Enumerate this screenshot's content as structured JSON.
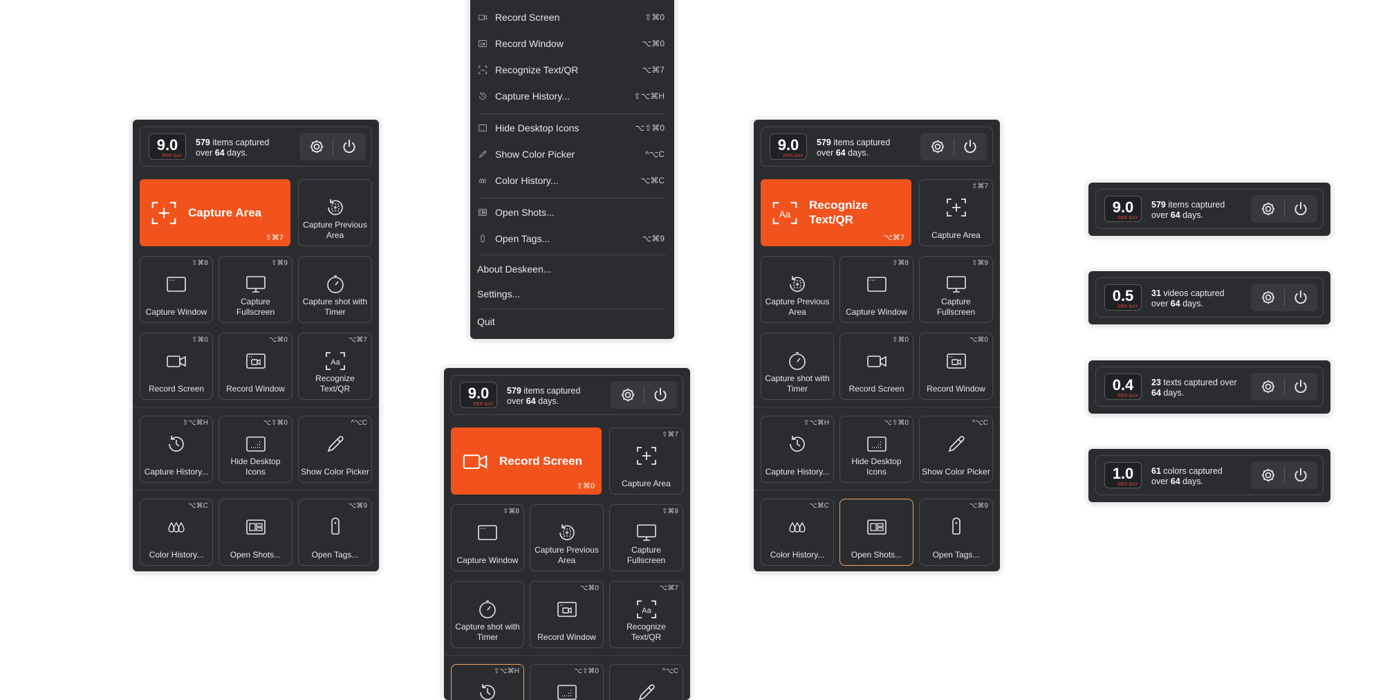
{
  "stats": {
    "main": {
      "rate": "9.0",
      "per_day": "PER DAY",
      "count": "579",
      "line1_rest": " items captured",
      "line2_pre": "over ",
      "days": "64",
      "line2_post": " days."
    },
    "videos": {
      "rate": "0.5",
      "per_day": "PER DAY",
      "count": "31",
      "line1_rest": " videos captured",
      "line2_pre": "over ",
      "days": "64",
      "line2_post": " days."
    },
    "texts": {
      "rate": "0.4",
      "per_day": "PER DAY",
      "count": "23",
      "line1_rest": " texts captured over",
      "line2_pre": "",
      "days": "64",
      "line2_post": " days."
    },
    "colors": {
      "rate": "1.0",
      "per_day": "PER DAY",
      "count": "61",
      "line1_rest": " colors captured",
      "line2_pre": "over ",
      "days": "64",
      "line2_post": " days."
    }
  },
  "labels": {
    "capture_area": "Capture Area",
    "capture_previous_area": "Capture Previous Area",
    "capture_window": "Capture Window",
    "capture_fullscreen": "Capture Fullscreen",
    "capture_timer": "Capture shot with Timer",
    "record_screen": "Record Screen",
    "record_window": "Record Window",
    "recognize_text": "Recognize Text/QR",
    "capture_history": "Capture History...",
    "hide_desktop_icons": "Hide Desktop Icons",
    "show_color_picker": "Show Color Picker",
    "color_history": "Color History...",
    "open_shots": "Open Shots...",
    "open_tags": "Open Tags..."
  },
  "shortcuts": {
    "capture_area": "⇧⌘7",
    "capture_window": "⇧⌘8",
    "capture_fullscreen": "⇧⌘9",
    "record_screen": "⇧⌘0",
    "record_window": "⌥⌘0",
    "recognize_text": "⌥⌘7",
    "capture_history": "⇧⌥⌘H",
    "hide_desktop_icons": "⌥⇧⌘0",
    "show_color_picker": "^⌥C",
    "color_history": "⌥⌘C",
    "open_tags": "⌥⌘9"
  },
  "menu": {
    "items": [
      {
        "label": "Record Screen",
        "shortcut": "⇧⌘0"
      },
      {
        "label": "Record Window",
        "shortcut": "⌥⌘0"
      },
      {
        "label": "Recognize Text/QR",
        "shortcut": "⌥⌘7"
      },
      {
        "label": "Capture History...",
        "shortcut": "⇧⌥⌘H"
      },
      {
        "label": "Hide Desktop Icons",
        "shortcut": "⌥⇧⌘0"
      },
      {
        "label": "Show Color Picker",
        "shortcut": "^⌥C"
      },
      {
        "label": "Color History...",
        "shortcut": "⌥⌘C"
      },
      {
        "label": "Open Shots...",
        "shortcut": ""
      },
      {
        "label": "Open Tags...",
        "shortcut": "⌥⌘9"
      },
      {
        "label": "About Deskeen...",
        "shortcut": ""
      },
      {
        "label": "Settings...",
        "shortcut": ""
      },
      {
        "label": "Quit",
        "shortcut": ""
      }
    ]
  },
  "colors": {
    "accent": "#f2521c",
    "panel": "#2b2c30",
    "highlight": "#e7a76b",
    "per_day": "#ef4b3c"
  }
}
